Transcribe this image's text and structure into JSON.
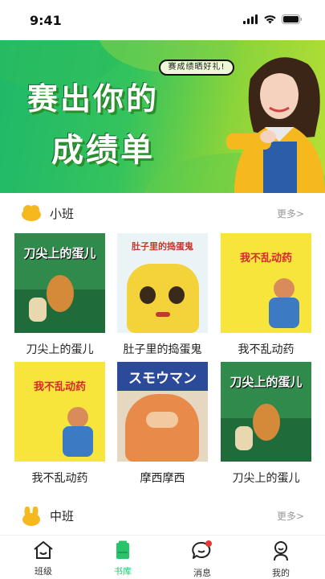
{
  "status_bar": {
    "time": "9:41"
  },
  "banner": {
    "pill_text": "赛成绩晒好礼!",
    "headline_line1": "赛出你的",
    "headline_line2": "成绩单"
  },
  "sections": [
    {
      "title": "小班",
      "more_label": "更多>",
      "books": [
        {
          "name": "刀尖上的蛋儿",
          "cover_title": "刀尖上的蛋儿"
        },
        {
          "name": "肚子里的捣蛋鬼",
          "cover_title": "肚子里的捣蛋鬼"
        },
        {
          "name": "我不乱动药",
          "cover_title": "我不乱动药"
        },
        {
          "name": "我不乱动药",
          "cover_title": "我不乱动药"
        },
        {
          "name": "摩西摩西",
          "cover_title": "スモウマン"
        },
        {
          "name": "刀尖上的蛋儿",
          "cover_title": "刀尖上的蛋儿"
        }
      ]
    },
    {
      "title": "中班",
      "more_label": "更多>"
    }
  ],
  "tabbar": {
    "items": [
      {
        "label": "班级",
        "icon": "house-icon"
      },
      {
        "label": "书库",
        "icon": "book-stack-icon"
      },
      {
        "label": "消息",
        "icon": "chat-bubble-icon"
      },
      {
        "label": "我的",
        "icon": "person-icon"
      }
    ],
    "active_index": 1,
    "accent_color": "#29c46a"
  }
}
